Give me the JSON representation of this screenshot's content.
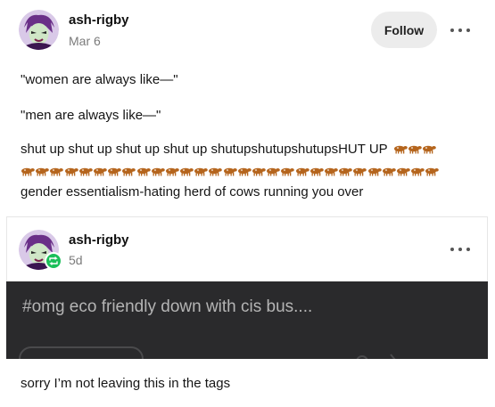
{
  "post": {
    "author": "ash-rigby",
    "date": "Mar 6",
    "follow_label": "Follow",
    "lines": [
      "\"women are always like—\"",
      "\"men are always like—\"",
      "shut up shut up shut up shut up shutupshutupshutupsHUT UP",
      "gender essentialism-hating herd of cows running you over"
    ]
  },
  "reblog": {
    "author": "ash-rigby",
    "date": "5d",
    "image_text": "#omg eco friendly down with cis bus....",
    "caption": "sorry I’m not leaving this in the tags"
  },
  "icons": {
    "more": "more-horizontal-icon",
    "reblog": "reblog-icon",
    "cow": "cow-emoji-icon"
  },
  "colors": {
    "follow_bg": "#ececec",
    "reblog_badge": "#1bbf5a",
    "cow": "#b5651d",
    "image_bg": "#2a2a2c"
  }
}
